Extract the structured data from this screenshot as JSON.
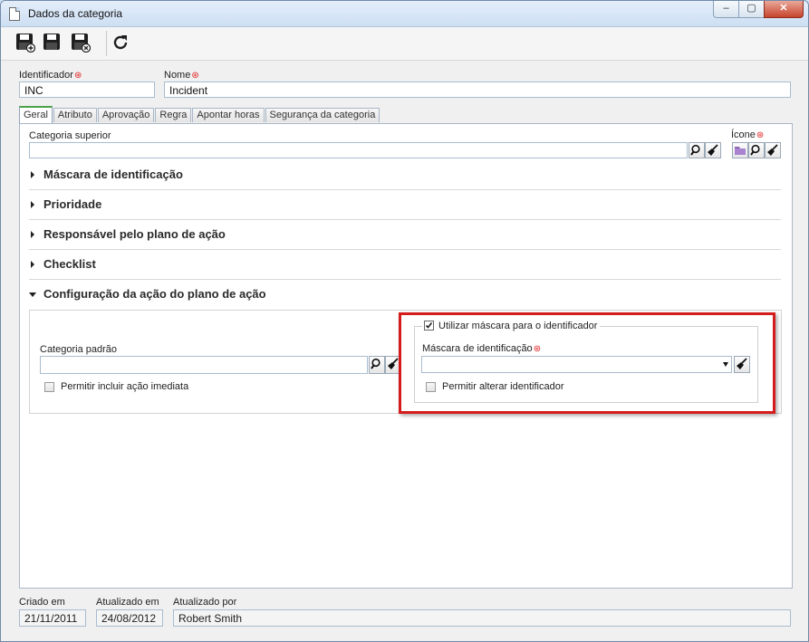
{
  "window": {
    "title": "Dados da categoria",
    "controls": {
      "minimize": "‒",
      "maximize": "▢",
      "close": "✕"
    }
  },
  "toolbar": {
    "buttons": [
      {
        "name": "save-new",
        "icon": "floppy-plus-icon"
      },
      {
        "name": "save",
        "icon": "floppy-icon"
      },
      {
        "name": "save-close",
        "icon": "floppy-close-icon"
      },
      {
        "name": "refresh",
        "icon": "refresh-icon"
      }
    ]
  },
  "form": {
    "identificador": {
      "label": "Identificador",
      "value": "INC"
    },
    "nome": {
      "label": "Nome",
      "value": "Incident"
    },
    "required_mark": "⊛"
  },
  "tabs": [
    "Geral",
    "Atributo",
    "Aprovação",
    "Regra",
    "Apontar horas",
    "Segurança da categoria"
  ],
  "geral": {
    "categoria_superior": {
      "label": "Categoria superior",
      "value": ""
    },
    "icone": {
      "label": "Ícone"
    },
    "sections": [
      {
        "title": "Máscara de identificação",
        "expanded": false
      },
      {
        "title": "Prioridade",
        "expanded": false
      },
      {
        "title": "Responsável pelo plano de ação",
        "expanded": false
      },
      {
        "title": "Checklist",
        "expanded": false
      },
      {
        "title": "Configuração da ação do plano de ação",
        "expanded": true
      }
    ],
    "config": {
      "categoria_padrao": {
        "label": "Categoria padrão",
        "value": ""
      },
      "permitir_incluir": {
        "label": "Permitir incluir ação imediata",
        "checked": false
      },
      "utilizar_mascara": {
        "label": "Utilizar máscara para o identificador",
        "checked": true
      },
      "mascara": {
        "label": "Máscara de identificação",
        "value": ""
      },
      "permitir_alterar": {
        "label": "Permitir alterar identificador",
        "checked": false
      }
    }
  },
  "footer": {
    "criado_em": {
      "label": "Criado em",
      "value": "21/11/2011"
    },
    "atualizado_em": {
      "label": "Atualizado em",
      "value": "24/08/2012"
    },
    "atualizado_por": {
      "label": "Atualizado por",
      "value": "Robert Smith"
    }
  },
  "colors": {
    "highlight": "#d51c1c",
    "active_tab": "#4aa34a",
    "required": "#e02020"
  }
}
